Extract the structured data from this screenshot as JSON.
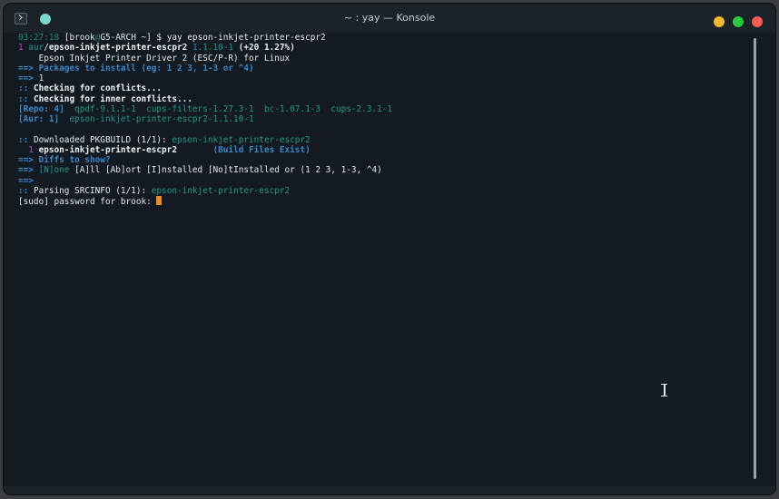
{
  "window": {
    "title": "~ : yay — Konsole"
  },
  "terminal": {
    "lines": [
      [
        {
          "c": "c-time",
          "t": "03:27:18"
        },
        {
          "c": "c-white",
          "t": " [brook"
        },
        {
          "c": "c-dim",
          "t": "@"
        },
        {
          "c": "c-white",
          "t": "G5-ARCH ~] $ yay epson-inkjet-printer-escpr2"
        }
      ],
      [
        {
          "c": "c-magenta",
          "t": "1 "
        },
        {
          "c": "c-teal",
          "t": "aur"
        },
        {
          "c": "c-white",
          "t": "/"
        },
        {
          "c": "c-bold",
          "t": "epson-inkjet-printer-escpr2"
        },
        {
          "c": "c-teal",
          "t": " 1.1.10-1 "
        },
        {
          "c": "c-bold",
          "t": "(+20 1.27%)"
        }
      ],
      [
        {
          "c": "c-white",
          "t": "    Epson Inkjet Printer Driver 2 (ESC/P-R) for Linux"
        }
      ],
      [
        {
          "c": "c-blue-bold",
          "t": "==> Packages to install (eg: 1 2 3, 1-3 or ^4)"
        }
      ],
      [
        {
          "c": "c-blue-bold",
          "t": "==> "
        },
        {
          "c": "c-white",
          "t": "1"
        }
      ],
      [
        {
          "c": "c-blue-bold",
          "t": ":: "
        },
        {
          "c": "c-bold",
          "t": "Checking for conflicts..."
        }
      ],
      [
        {
          "c": "c-blue-bold",
          "t": ":: "
        },
        {
          "c": "c-bold",
          "t": "Checking for inner conflicts..."
        }
      ],
      [
        {
          "c": "c-blue-bold",
          "t": "[Repo: 4]"
        },
        {
          "c": "c-teal",
          "t": "  qpdf-9.1.1-1  cups-filters-1.27.3-1  bc-1.07.1-3  cups-2.3.1-1"
        }
      ],
      [
        {
          "c": "c-blue-bold",
          "t": "[Aur: 1]"
        },
        {
          "c": "c-teal",
          "t": "  epson-inkjet-printer-escpr2-1.1.10-1"
        }
      ],
      [
        {
          "c": "c-white",
          "t": ""
        }
      ],
      [
        {
          "c": "c-blue-bold",
          "t": ":: "
        },
        {
          "c": "c-white",
          "t": "Downloaded PKGBUILD (1/1): "
        },
        {
          "c": "c-teal",
          "t": "epson-inkjet-printer-escpr2"
        }
      ],
      [
        {
          "c": "c-purple-num",
          "t": "  1 "
        },
        {
          "c": "c-bold",
          "t": "epson-inkjet-printer-escpr2"
        },
        {
          "c": "c-blue-bold",
          "t": "       (Build Files Exist)"
        }
      ],
      [
        {
          "c": "c-blue-bold",
          "t": "==> Diffs to show?"
        }
      ],
      [
        {
          "c": "c-blue-bold",
          "t": "==> "
        },
        {
          "c": "c-teal",
          "t": "[N]one "
        },
        {
          "c": "c-white",
          "t": "[A]ll [Ab]ort [I]nstalled [No]tInstalled or (1 2 3, 1-3, ^4)"
        }
      ],
      [
        {
          "c": "c-blue-bold",
          "t": "==>"
        }
      ],
      [
        {
          "c": "c-blue-bold",
          "t": ":: "
        },
        {
          "c": "c-white",
          "t": "Parsing SRCINFO (1/1): "
        },
        {
          "c": "c-teal",
          "t": "epson-inkjet-printer-escpr2"
        }
      ],
      [
        {
          "c": "c-white",
          "t": "[sudo] password for brook: "
        },
        {
          "c": "cursor",
          "t": ""
        }
      ]
    ]
  }
}
